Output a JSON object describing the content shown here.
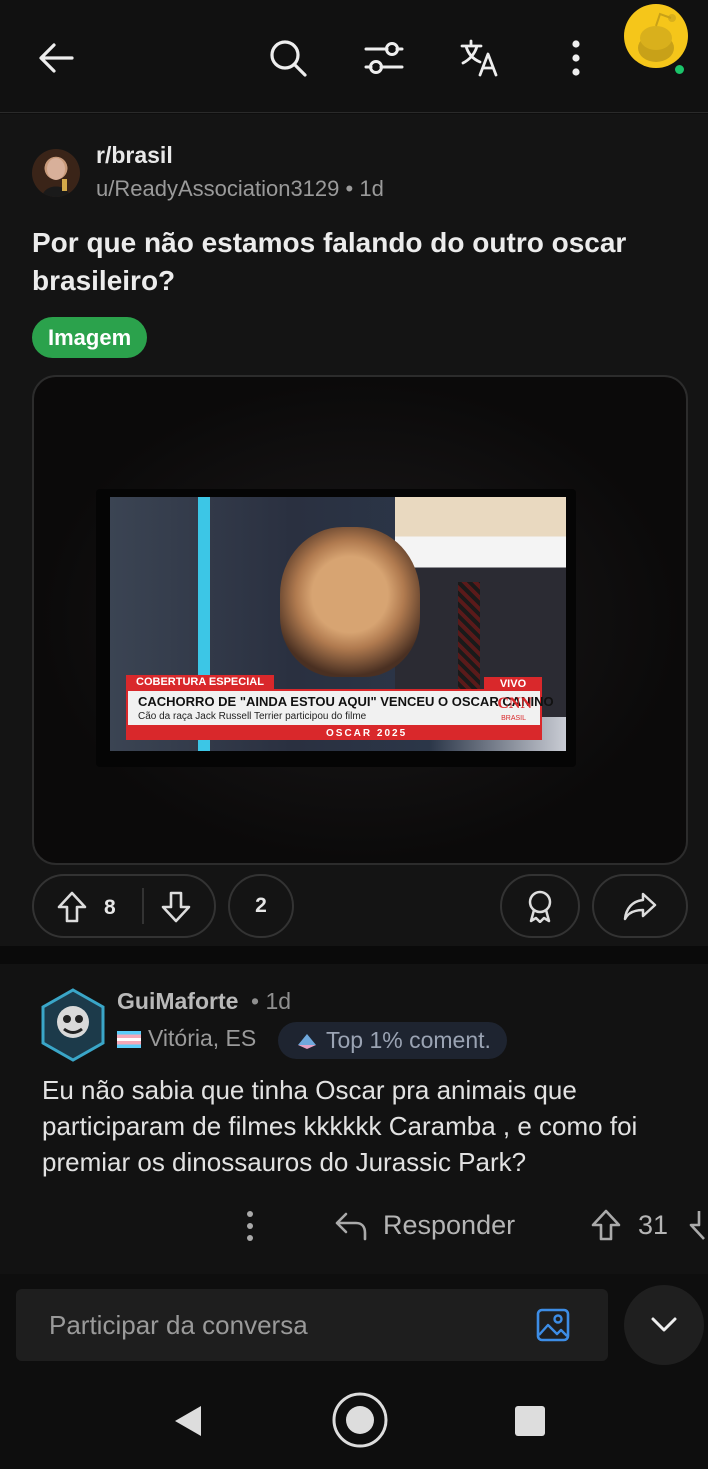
{
  "topbar": {
    "icons": [
      "back-arrow-icon",
      "search-icon",
      "filter-icon",
      "translate-icon",
      "more-vertical-icon",
      "user-avatar"
    ],
    "online_color": "#1bc46a"
  },
  "post": {
    "subreddit": "r/brasil",
    "author": "u/ReadyAssociation3129",
    "separator": "•",
    "age": "1d",
    "title": "Por que não estamos falando do outro oscar brasileiro?",
    "flair": "Imagem",
    "flair_color": "#2ba24c",
    "image": {
      "tag": "COBERTURA ESPECIAL",
      "live": "VIVO",
      "headline": "CACHORRO DE \"AINDA ESTOU AQUI\" VENCEU O OSCAR CANINO",
      "subline": "Cão da raça Jack Russell Terrier participou do filme",
      "logo": "CNN",
      "logo_sub": "BRASIL",
      "ticker": "OSCAR 2025"
    },
    "votes": "8",
    "comments": "2"
  },
  "comment": {
    "username": "GuiMaforte",
    "age": "• 1d",
    "location": "Vitória, ES",
    "badge": "Top 1% coment.",
    "body_lines": [
      "Eu não sabia que tinha Oscar pra animais que",
      "participaram de filmes kkkkkk Caramba , e como foi",
      "premiar os dinossauros do Jurassic Park?"
    ],
    "reply_label": "Responder",
    "votes": "31"
  },
  "composer": {
    "placeholder": "Participar da conversa"
  },
  "navbar": {
    "icons": [
      "back-triangle-icon",
      "home-circle-icon",
      "recents-square-icon"
    ]
  }
}
